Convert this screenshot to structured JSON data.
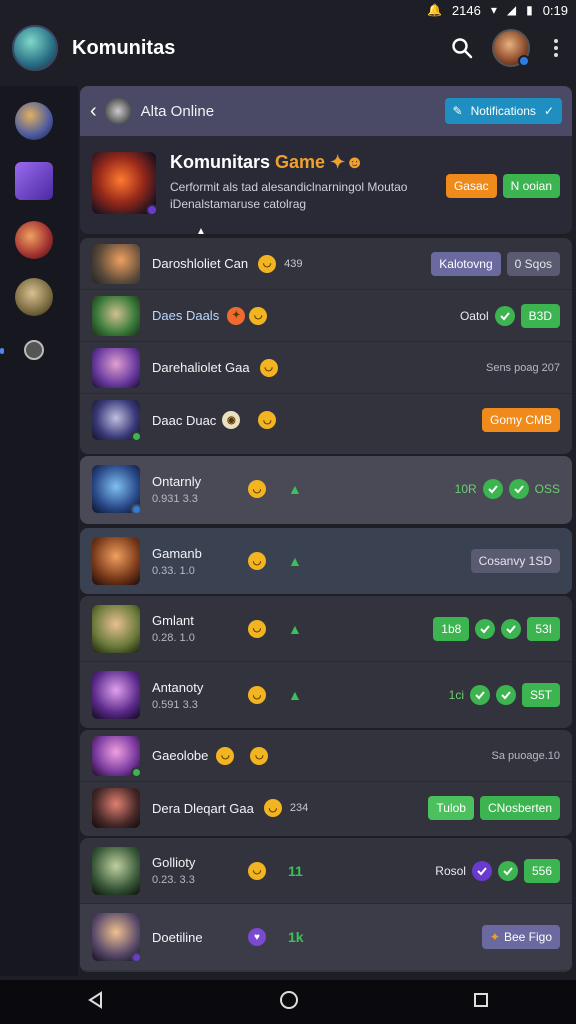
{
  "status": {
    "time": "0:19",
    "battery": "2146"
  },
  "appbar": {
    "title": "Komunitas"
  },
  "panel": {
    "header_label": "Alta Online",
    "notif_label": "Notifications",
    "game_title": "Komunitars",
    "game_word": "Game",
    "game_desc": "Cerformit als tad alesandiclnarningol Moutao iDenalstamaruse catolrag",
    "btn_orange": "Gasac",
    "btn_green": "N ooian"
  },
  "list_a": [
    {
      "title": "Daroshloliet Can",
      "meta": "439",
      "tag1": "Kalotovng",
      "tag2": "0 Sqos"
    },
    {
      "title": "Daes Daals",
      "tag_text": "Oatol",
      "tag_value": "B3D"
    },
    {
      "title": "Darehaliolet Gaa",
      "tag_text": "Sens poag 207"
    },
    {
      "title": "Daac Duac",
      "tag_value": "Gomy CMB"
    }
  ],
  "list_b": [
    {
      "title": "Ontarnly",
      "sub": "0.931 3.3",
      "left": "10R",
      "right": "OSS"
    }
  ],
  "list_c": [
    {
      "title": "Gamanb",
      "sub": "0.33. 1.0",
      "tag": "Cosanvy 1SD"
    }
  ],
  "list_d": [
    {
      "title": "Gmlant",
      "sub": "0.28. 1.0",
      "left": "1b8",
      "right": "53I"
    },
    {
      "title": "Antanoty",
      "sub": "0.591 3.3",
      "left": "1ci",
      "right": "S5T"
    }
  ],
  "list_e": [
    {
      "title": "Gaeolobe",
      "tag": "Sa puoage.10"
    },
    {
      "title": "Dera Dleqart Gaa",
      "meta": "234",
      "tag1": "Tulob",
      "tag2": "CNosberten"
    }
  ],
  "list_f": [
    {
      "title": "Gollioty",
      "sub": "0.23. 3.3",
      "mid": "11",
      "left": "Rosol",
      "right": "556"
    },
    {
      "title": "Doetiline",
      "mid": "1k",
      "tag": "Bee Figo"
    }
  ]
}
